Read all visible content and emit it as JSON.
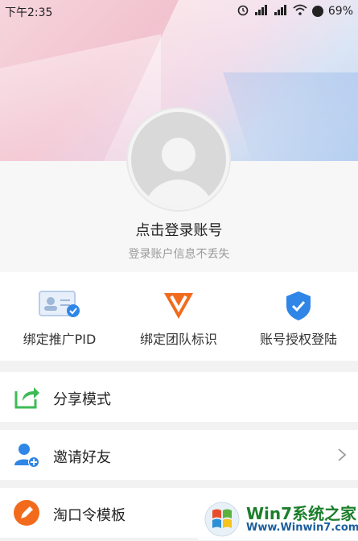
{
  "status_bar": {
    "time": "下午2:35",
    "battery": "69%"
  },
  "login": {
    "title": "点击登录账号",
    "subtitle": "登录账户信息不丢失"
  },
  "actions": [
    {
      "label": "绑定推广PID",
      "icon": "id-card-check-icon"
    },
    {
      "label": "绑定团队标识",
      "icon": "team-v-icon"
    },
    {
      "label": "账号授权登陆",
      "icon": "shield-check-icon"
    }
  ],
  "menu": [
    {
      "label": "分享模式",
      "icon": "share-icon"
    },
    {
      "label": "邀请好友",
      "icon": "add-friend-icon"
    },
    {
      "label": "淘口令模板",
      "icon": "pencil-icon"
    }
  ],
  "watermark": {
    "brand": "Win7系统之家",
    "url": "Www.Winwin7.com"
  },
  "colors": {
    "accent_orange": "#f26b1d",
    "share_green": "#3dbb55",
    "blue": "#2f86e6"
  }
}
